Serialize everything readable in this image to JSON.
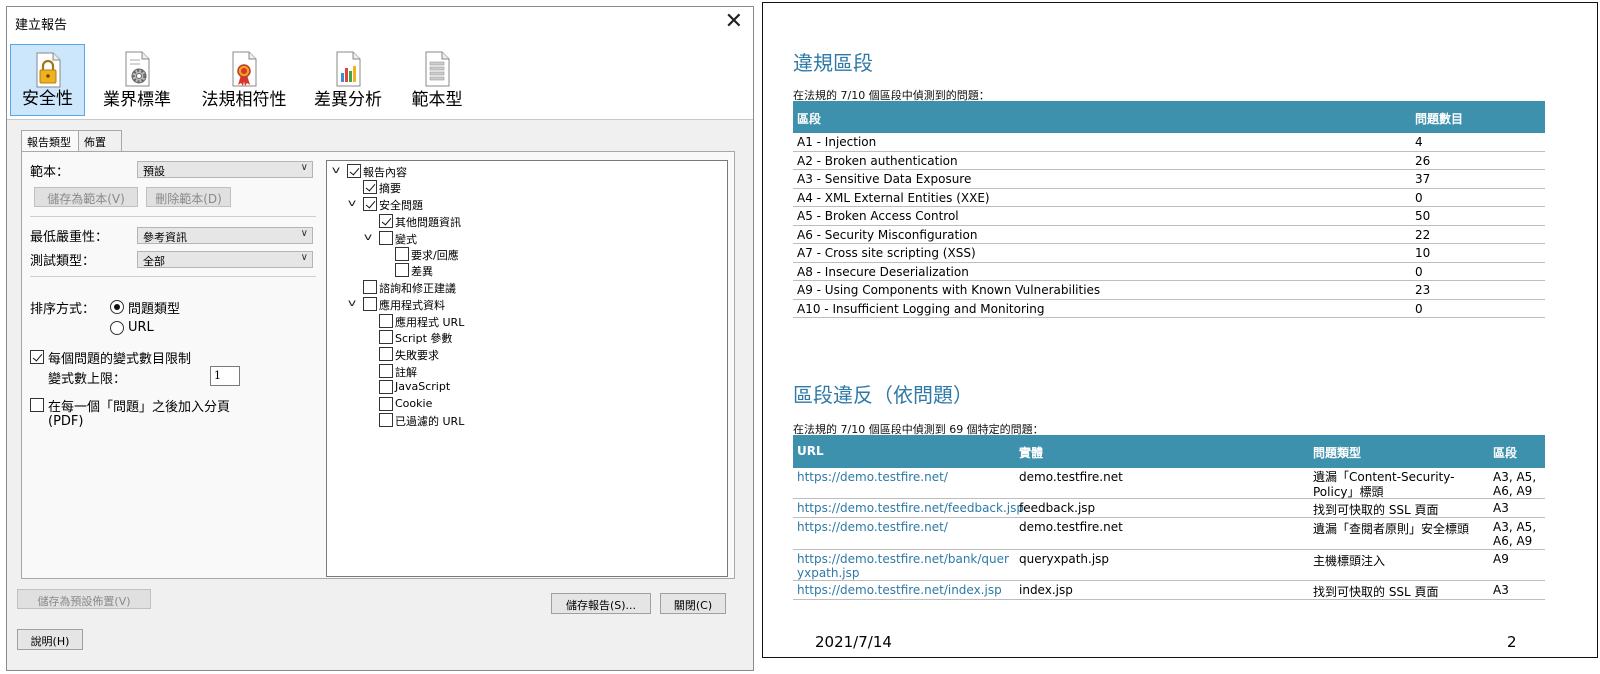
{
  "dialog": {
    "title": "建立報告",
    "categories": [
      {
        "label": "安全性",
        "icon": "lock-report-icon",
        "selected": true
      },
      {
        "label": "業界標準",
        "icon": "gear-report-icon",
        "selected": false
      },
      {
        "label": "法規相符性",
        "icon": "ribbon-report-icon",
        "selected": false
      },
      {
        "label": "差異分析",
        "icon": "chart-report-icon",
        "selected": false
      },
      {
        "label": "範本型",
        "icon": "template-report-icon",
        "selected": false
      }
    ],
    "tabs": [
      "報告類型",
      "佈置"
    ],
    "template_label": "範本：",
    "template_value": "預設",
    "save_template": "儲存為範本(V)",
    "delete_template": "刪除範本(D)",
    "min_severity_label": "最低嚴重性：",
    "min_severity_value": "參考資訊",
    "test_type_label": "測試類型：",
    "test_type_value": "全部",
    "sort_label": "排序方式：",
    "sort_options": [
      {
        "label": "問題類型",
        "selected": true
      },
      {
        "label": "URL",
        "selected": false
      }
    ],
    "variant_limit_label": "每個問題的變式數目限制",
    "variant_limit_checked": true,
    "variant_max_label": "變式數上限：",
    "variant_max_value": "1",
    "page_break_label": "在每一個「問題」之後加入分頁",
    "page_break_sub": "(PDF)",
    "page_break_checked": false,
    "tree": [
      {
        "label": "報告內容",
        "checked": true,
        "expanded": true
      },
      {
        "label": "摘要",
        "checked": true
      },
      {
        "label": "安全問題",
        "checked": true,
        "expanded": true
      },
      {
        "label": "其他問題資訊",
        "checked": true
      },
      {
        "label": "變式",
        "checked": false,
        "expanded": true
      },
      {
        "label": "要求/回應",
        "checked": false
      },
      {
        "label": "差異",
        "checked": false
      },
      {
        "label": "諮詢和修正建議",
        "checked": false
      },
      {
        "label": "應用程式資料",
        "checked": false,
        "expanded": true
      },
      {
        "label": "應用程式 URL",
        "checked": false
      },
      {
        "label": "Script 參數",
        "checked": false
      },
      {
        "label": "失敗要求",
        "checked": false
      },
      {
        "label": "註解",
        "checked": false
      },
      {
        "label": "JavaScript",
        "checked": false
      },
      {
        "label": "Cookie",
        "checked": false
      },
      {
        "label": "已過濾的 URL",
        "checked": false
      }
    ],
    "save_default_layout": "儲存為預設佈置(V)",
    "save_report": "儲存報告(S)...",
    "close": "關閉(C)",
    "help": "說明(H)"
  },
  "report": {
    "section1_title": "違規區段",
    "section1_sub": "在法規的 7/10 個區段中偵測到的問題：",
    "section1_headers": [
      "區段",
      "問題數目"
    ],
    "section1_rows": [
      [
        "A1 - Injection",
        "4"
      ],
      [
        "A2 - Broken authentication",
        "26"
      ],
      [
        "A3 - Sensitive Data Exposure",
        "37"
      ],
      [
        "A4 - XML External Entities (XXE)",
        "0"
      ],
      [
        "A5 - Broken Access Control",
        "50"
      ],
      [
        "A6 - Security Misconfiguration",
        "22"
      ],
      [
        "A7 - Cross site scripting (XSS)",
        "10"
      ],
      [
        "A8 - Insecure Deserialization",
        "0"
      ],
      [
        "A9 - Using Components with Known Vulnerabilities",
        "23"
      ],
      [
        "A10 - Insufficient Logging and Monitoring",
        "0"
      ]
    ],
    "section2_title": "區段違反（依問題）",
    "section2_sub": "在法規的 7/10 個區段中偵測到 69 個特定的問題：",
    "section2_headers": [
      "URL",
      "實體",
      "問題類型",
      "區段"
    ],
    "section2_rows": [
      {
        "url": "https://demo.testfire.net/",
        "entity": "demo.testfire.net",
        "issue": "遺漏「Content-Security-Policy」標頭",
        "section": "A3, A5, A6, A9"
      },
      {
        "url": "https://demo.testfire.net/feedback.jsp",
        "entity": "feedback.jsp",
        "issue": "找到可快取的 SSL 頁面",
        "section": "A3"
      },
      {
        "url": "https://demo.testfire.net/",
        "entity": "demo.testfire.net",
        "issue": "遺漏「查閱者原則」安全標頭",
        "section": "A3, A5, A6, A9"
      },
      {
        "url": "https://demo.testfire.net/bank/queryxpath.jsp",
        "entity": "queryxpath.jsp",
        "issue": "主機標頭注入",
        "section": "A9"
      },
      {
        "url": "https://demo.testfire.net/index.jsp",
        "entity": "index.jsp",
        "issue": "找到可快取的 SSL 頁面",
        "section": "A3"
      }
    ],
    "footer_date": "2021/7/14",
    "footer_page": "2"
  }
}
